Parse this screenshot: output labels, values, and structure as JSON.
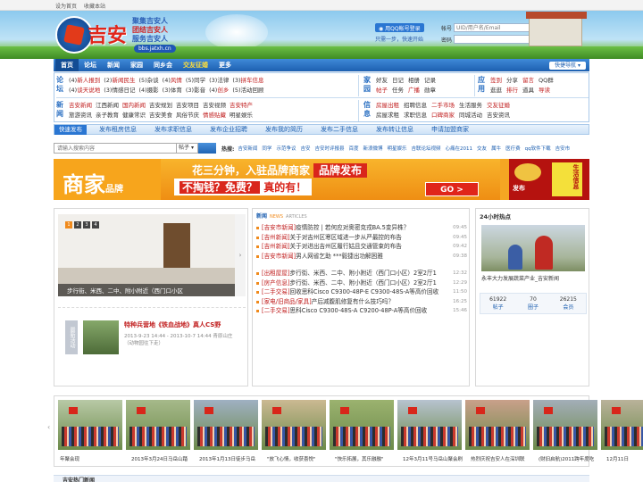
{
  "topbar": {
    "homepage": "设为首页",
    "favorite": "收藏本站"
  },
  "header": {
    "logo_text": "吉安",
    "slogan": [
      "聚集吉安人",
      "团结吉安人",
      "服务吉安人"
    ],
    "domain": "bbs.jatxh.cn",
    "qq_login": "用QQ帐号登录",
    "login_links": "只需一步，快速开始",
    "account_label": "帐号",
    "account_placeholder": "UID/用户名/Email",
    "password_label": "密码",
    "login_button": "登录"
  },
  "nav": {
    "items": [
      {
        "label": "首页"
      },
      {
        "label": "论坛"
      },
      {
        "label": "新闻"
      },
      {
        "label": "家园"
      },
      {
        "label": "同乡会"
      },
      {
        "label": "交友征婚"
      },
      {
        "label": "更多"
      }
    ],
    "quick": "快捷导航"
  },
  "categories": {
    "forum": {
      "title": "论坛",
      "row1": [
        {
          "n": "(4)",
          "t": "新人报到",
          "r": true
        },
        {
          "n": "(2)",
          "t": "新闻民生",
          "r": true
        },
        {
          "n": "(5)",
          "t": "杂谈",
          "r": false
        },
        {
          "n": "(4)",
          "t": "风情",
          "r": true
        },
        {
          "n": "(5)",
          "t": "同学",
          "r": false
        },
        {
          "n": "(3)",
          "t": "法律",
          "r": false
        },
        {
          "n": "(3)",
          "t": "拼车信息",
          "r": true
        }
      ],
      "row2": [
        {
          "n": "(4)",
          "t": "谈天说地",
          "r": true
        },
        {
          "n": "(3)",
          "t": "情感日记",
          "r": false
        },
        {
          "n": "(4)",
          "t": "摄影",
          "r": false
        },
        {
          "n": "(3)",
          "t": "体育",
          "r": false
        },
        {
          "n": "(3)",
          "t": "影音",
          "r": false
        },
        {
          "n": "(4)",
          "t": "创乡",
          "r": true
        },
        {
          "n": "(5)",
          "t": "活动回顾",
          "r": false
        }
      ]
    },
    "home": {
      "title": "家园",
      "row1": [
        {
          "t": "好友",
          "r": false
        },
        {
          "t": "日记",
          "r": false
        },
        {
          "t": "相册",
          "r": false
        },
        {
          "t": "记录",
          "r": false
        }
      ],
      "row2": [
        {
          "t": "帖子",
          "r": true
        },
        {
          "t": "任务",
          "r": false
        },
        {
          "t": "广播",
          "r": true
        },
        {
          "t": "勋章",
          "r": false
        }
      ]
    },
    "apps": {
      "title": "应用",
      "row1": [
        {
          "t": "签到",
          "r": true
        },
        {
          "t": "分享",
          "r": false
        },
        {
          "t": "留言",
          "r": true
        },
        {
          "t": "QQ群",
          "r": false
        }
      ],
      "row2": [
        {
          "t": "逛逛",
          "r": false
        },
        {
          "t": "排行",
          "r": true
        },
        {
          "t": "道具",
          "r": false
        },
        {
          "t": "导读",
          "r": true
        }
      ]
    },
    "news": {
      "title": "新闻",
      "row1": [
        {
          "t": "吉安新闻",
          "r": true
        },
        {
          "t": "江西新闻",
          "r": false
        },
        {
          "t": "国内新闻",
          "r": true
        },
        {
          "t": "吉安规划",
          "r": false
        },
        {
          "t": "吉安项目",
          "r": false
        },
        {
          "t": "吉安视频",
          "r": false
        },
        {
          "t": "吉安特产",
          "r": true
        }
      ],
      "row2": [
        {
          "t": "旅游资讯",
          "r": false
        },
        {
          "t": "亲子教育",
          "r": false
        },
        {
          "t": "健康常识",
          "r": false
        },
        {
          "t": "吉安美食",
          "r": false
        },
        {
          "t": "风俗节庆",
          "r": false
        },
        {
          "t": "情感贴藏",
          "r": true
        },
        {
          "t": "明星娱乐",
          "r": false
        }
      ]
    },
    "info": {
      "title": "信息",
      "row1": [
        {
          "t": "房屋出租",
          "r": true
        },
        {
          "t": "招聘信息",
          "r": false
        },
        {
          "t": "二手市场",
          "r": true
        },
        {
          "t": "生活服务",
          "r": false
        },
        {
          "t": "交友征婚",
          "r": true
        }
      ],
      "row2": [
        {
          "t": "房屋求租",
          "r": false
        },
        {
          "t": "求职信息",
          "r": false
        },
        {
          "t": "口碑商家",
          "r": true
        },
        {
          "t": "同城活动",
          "r": false
        },
        {
          "t": "吉安资讯",
          "r": false
        }
      ]
    }
  },
  "publish": {
    "button": "快速发布",
    "links": [
      "发布租房信息",
      "发布求职信息",
      "发布企业招聘",
      "发布我的简历",
      "发布二手信息",
      "发布转让信息",
      "申请加盟商家"
    ]
  },
  "search": {
    "placeholder": "请输入搜索内容",
    "scope": "帖子",
    "hot_label": "热搜:",
    "keywords": [
      "吉安新闻",
      "同学",
      "示范争议",
      "吉安",
      "吉安时评报县",
      "百度",
      "新浪微博",
      "明星娱乐",
      "吉联论坛视频",
      "心痛在2011",
      "交友",
      "属牛",
      "医疗费",
      "qq软件下载",
      "吉安市"
    ]
  },
  "ad": {
    "left": "商家",
    "left_small": "品牌",
    "mid_line1": "花三分钟，入驻品牌商家",
    "mid_line1_tag": "品牌发布",
    "mid_line2": "不掏钱？免费？",
    "mid_line2_tail": "真的有！",
    "go": "GO >",
    "right_vertical": "生活信息",
    "right_title": "发布"
  },
  "slideshow": {
    "dots": [
      "1",
      "2",
      "3",
      "4"
    ],
    "caption": "步行街、米西、二中、附小附近（西门口小区",
    "arrow": "›"
  },
  "featured": {
    "tag": "最新活动",
    "title": "特种兵营地《铁血战地》真人CS野",
    "date": "2013-9-23 14:44 - 2013-10-7 14:44 青原山庄",
    "note": "（动物园往下走）"
  },
  "news": {
    "header": "新闻",
    "header_sub": "NEWS",
    "header_sub2": "ARTICLES",
    "group1": [
      {
        "tag": "[吉安市新闻]",
        "title": "疫情防控 | 若何应对奥密克戎BA.5变异株？",
        "time": "09:45"
      },
      {
        "tag": "[吉州新闻]",
        "title": "关于对吉州区寒区域进一步从严最控的布告",
        "time": "09:45"
      },
      {
        "tag": "[吉州新闻]",
        "title": "关于对进出吉州区履行姑且交通管束的布告",
        "time": "09:42"
      },
      {
        "tag": "[吉安市新闻]",
        "title": "男人网省乞助 ***毅捷出功解困雅",
        "time": "09:38"
      }
    ],
    "group2": [
      {
        "tag": "[出租屋屋]",
        "title": "步行街、米西、二中、附小附近（西门口小区）2室2厅1",
        "time": "12:32"
      },
      {
        "tag": "[房产信息]",
        "title": "步行街、米西、二中、附小附近（西门口小区）2室2厅1",
        "time": "12:29"
      },
      {
        "tag": "[二手交易]",
        "title": "回收思科Cisco C9300-48P-E C9300-48S-A等高价回收",
        "time": "11:50"
      },
      {
        "tag": "[家电/旧商品/家具]",
        "title": "产后减腹肌修复有什么技巧吗？",
        "time": "16:25"
      },
      {
        "tag": "[二手交易]",
        "title": "思科Cisco C9300-48S-A C9200-48P-A等高价回收",
        "time": "15:46"
      }
    ]
  },
  "hot": {
    "header": "24小时热点",
    "caption": "永丰大力发展蔬菜产业_吉安新闻",
    "stats": [
      {
        "value": "61922",
        "label": "帖子"
      },
      {
        "value": "70",
        "label": "圈子"
      },
      {
        "value": "26215",
        "label": "会员"
      }
    ]
  },
  "photos": {
    "left_arrow": "‹",
    "right_arrow": "›",
    "items": [
      {
        "caption": "年聚会现",
        "bg": "#b8c9a6"
      },
      {
        "caption": "2013年3月24日马岳山踏",
        "bg": "#a6b98a"
      },
      {
        "caption": "2013年1月13日徒步马岳",
        "bg": "#9fb0c2"
      },
      {
        "caption": "\"放飞心情，收获喜悦\"",
        "bg": "#cbb992"
      },
      {
        "caption": "\"快乐拓展，其乐融融\"",
        "bg": "#9bb26f"
      },
      {
        "caption": "12年3月11号马岳山聚会刷",
        "bg": "#b7c3cf"
      },
      {
        "caption": "热烈庆祝吉安人在深圳联",
        "bg": "#c9a08a"
      },
      {
        "caption": "(财旧启航)2011跨年度吃",
        "bg": "#a3aeb8"
      },
      {
        "caption": "12月11日",
        "bg": "#b9b29a"
      }
    ]
  },
  "bottom": {
    "title": "吉安热门新闻"
  }
}
